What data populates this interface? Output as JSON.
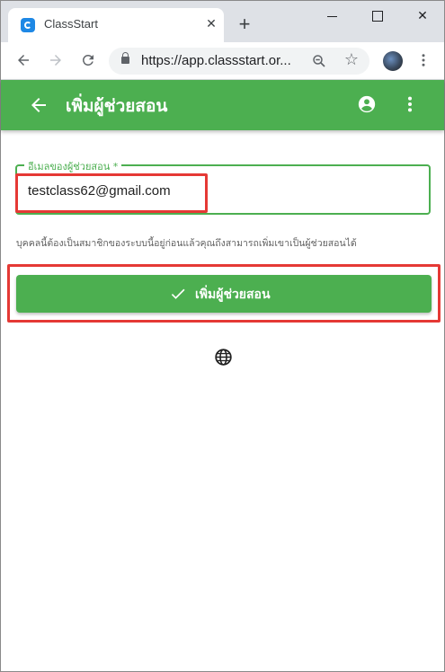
{
  "browser": {
    "tab_title": "ClassStart",
    "tab_close": "✕",
    "new_tab": "+",
    "url": "https://app.classstart.or...",
    "window_close": "✕"
  },
  "appbar": {
    "title": "เพิ่มผู้ช่วยสอน"
  },
  "form": {
    "email_label": "อีเมลของผู้ช่วยสอน *",
    "email_value": "testclass62@gmail.com",
    "hint": "บุคคลนี้ต้องเป็นสมาชิกของระบบนี้อยู่ก่อนแล้วคุณถึงสามารถเพิ่มเขาเป็นผู้ช่วยสอนได้",
    "submit_label": "เพิ่มผู้ช่วยสอน"
  },
  "icons": {
    "back": "arrow-back-icon",
    "account": "account-circle-icon",
    "more": "more-vert-icon",
    "check": "check-icon",
    "language": "globe-icon"
  },
  "colors": {
    "primary": "#4caf50",
    "highlight": "#e53935",
    "tabstrip": "#dee1e6"
  }
}
